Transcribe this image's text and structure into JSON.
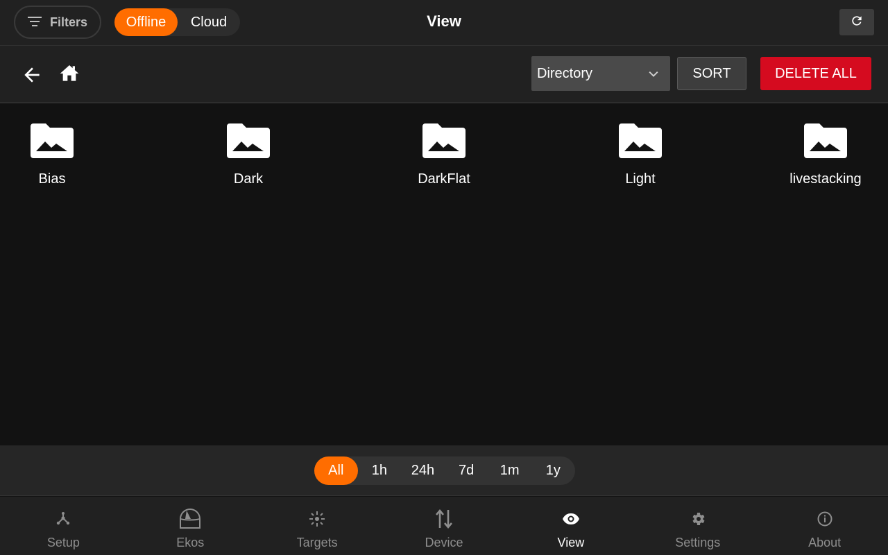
{
  "header": {
    "filters_label": "Filters",
    "modes": [
      {
        "label": "Offline",
        "active": true
      },
      {
        "label": "Cloud",
        "active": false
      }
    ],
    "title": "View"
  },
  "toolbar": {
    "directory_select": "Directory",
    "sort_label": "SORT",
    "delete_all_label": "DELETE ALL"
  },
  "folders": [
    {
      "name": "Bias"
    },
    {
      "name": "Dark"
    },
    {
      "name": "DarkFlat"
    },
    {
      "name": "Light"
    },
    {
      "name": "livestacking"
    }
  ],
  "time_filters": [
    {
      "label": "All",
      "active": true
    },
    {
      "label": "1h",
      "active": false
    },
    {
      "label": "24h",
      "active": false
    },
    {
      "label": "7d",
      "active": false
    },
    {
      "label": "1m",
      "active": false
    },
    {
      "label": "1y",
      "active": false
    }
  ],
  "nav": [
    {
      "label": "Setup",
      "icon": "setup-icon",
      "active": false
    },
    {
      "label": "Ekos",
      "icon": "observatory-dome-icon",
      "active": false
    },
    {
      "label": "Targets",
      "icon": "star-target-icon",
      "active": false
    },
    {
      "label": "Device",
      "icon": "transfer-arrows-icon",
      "active": false
    },
    {
      "label": "View",
      "icon": "eye-icon",
      "active": true
    },
    {
      "label": "Settings",
      "icon": "gear-icon",
      "active": false
    },
    {
      "label": "About",
      "icon": "info-icon",
      "active": false
    }
  ],
  "colors": {
    "accent": "#ff6d00",
    "danger": "#d50b1f",
    "background": "#121212",
    "bar": "#212121"
  }
}
